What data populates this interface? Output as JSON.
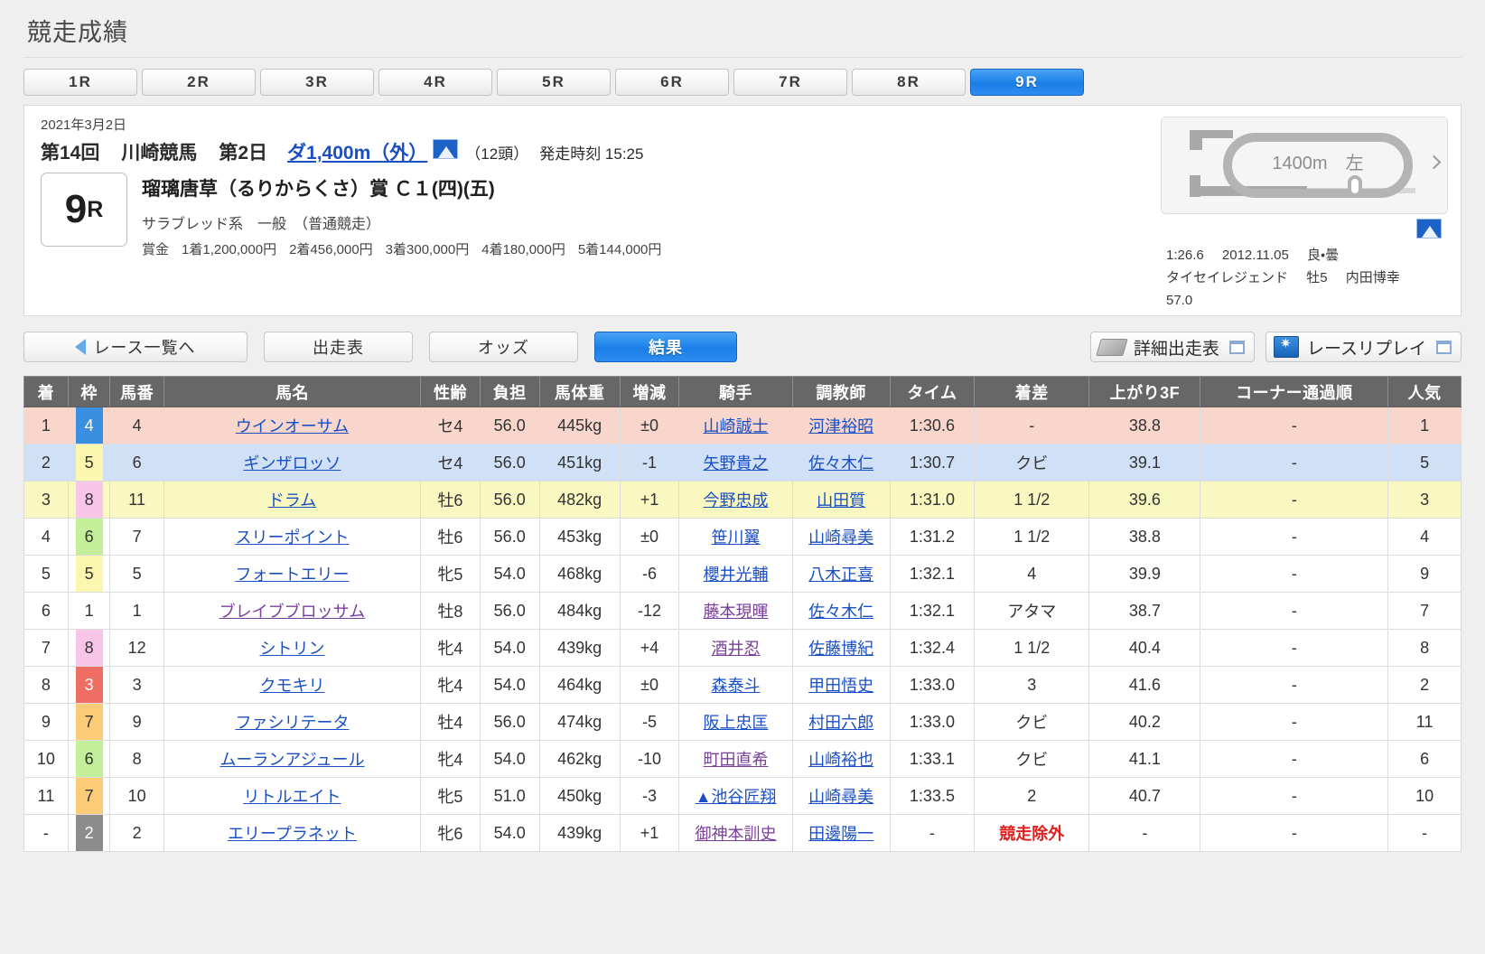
{
  "page": {
    "title": "競走成績"
  },
  "race_tabs": [
    {
      "label": "1R",
      "active": false
    },
    {
      "label": "2R",
      "active": false
    },
    {
      "label": "3R",
      "active": false
    },
    {
      "label": "4R",
      "active": false
    },
    {
      "label": "5R",
      "active": false
    },
    {
      "label": "6R",
      "active": false
    },
    {
      "label": "7R",
      "active": false
    },
    {
      "label": "8R",
      "active": false
    },
    {
      "label": "9R",
      "active": true
    }
  ],
  "race_info": {
    "date": "2021年3月2日",
    "kai": "第14回",
    "place": "川崎競馬",
    "day": "第2日",
    "distance_link": "ダ1,400m（外）",
    "head_count": "（12頭）",
    "start_time": "発走時刻 15:25",
    "race_no_num": "9",
    "race_no_suffix": "R",
    "race_name": "瑠璃唐草（るりからくさ）賞 Ｃ１(四)(五)",
    "condition": "サラブレッド系　一般　（普通競走）",
    "prize_label": "賞金",
    "prizes": [
      "1着1,200,000円",
      "2着456,000円",
      "3着300,000円",
      "4着180,000円",
      "5着144,000円"
    ]
  },
  "course": {
    "diagram_label": "1400m　左",
    "record_time": "1:26.6",
    "record_date": "2012.11.05",
    "record_cond": "良・曇",
    "record_horse": "タイセイレジェンド",
    "record_sex_age": "牡5",
    "record_jockey": "内田博幸",
    "record_weight": "57.0"
  },
  "nav_buttons": [
    {
      "label": "レース一覧へ",
      "active": false,
      "icon": "back-arrow-icon"
    },
    {
      "label": "出走表",
      "active": false,
      "icon": ""
    },
    {
      "label": "オッズ",
      "active": false,
      "icon": ""
    },
    {
      "label": "結果",
      "active": true,
      "icon": ""
    }
  ],
  "right_links": [
    {
      "label": "詳細出走表",
      "icon": "card-icon"
    },
    {
      "label": "レースリプレイ",
      "icon": "replay-icon"
    }
  ],
  "table": {
    "headers": [
      "着",
      "枠",
      "馬番",
      "馬名",
      "性齢",
      "負担",
      "馬体重",
      "増減",
      "騎手",
      "調教師",
      "タイム",
      "着差",
      "上がり3F",
      "コーナー通過順",
      "人気"
    ],
    "rows": [
      {
        "chaku": "1",
        "waku": "4",
        "umaban": "4",
        "name": "ウインオーサム",
        "sei": "セ4",
        "futan": "56.0",
        "weight": "445kg",
        "zougen": "±0",
        "jockey": "山崎誠士",
        "trainer": "河津裕昭",
        "time": "1:30.6",
        "diff": "-",
        "agari": "38.8",
        "corner": "-",
        "ninki": "1",
        "rank_class": "row-1",
        "jockey_visited": false,
        "name_visited": false,
        "excluded": false
      },
      {
        "chaku": "2",
        "waku": "5",
        "umaban": "6",
        "name": "ギンザロッソ",
        "sei": "セ4",
        "futan": "56.0",
        "weight": "451kg",
        "zougen": "-1",
        "jockey": "矢野貴之",
        "trainer": "佐々木仁",
        "time": "1:30.7",
        "diff": "クビ",
        "agari": "39.1",
        "corner": "-",
        "ninki": "5",
        "rank_class": "row-2",
        "jockey_visited": false,
        "name_visited": false,
        "excluded": false
      },
      {
        "chaku": "3",
        "waku": "8",
        "umaban": "11",
        "name": "ドラム",
        "sei": "牡6",
        "futan": "56.0",
        "weight": "482kg",
        "zougen": "+1",
        "jockey": "今野忠成",
        "trainer": "山田質",
        "time": "1:31.0",
        "diff": "1 1/2",
        "agari": "39.6",
        "corner": "-",
        "ninki": "3",
        "rank_class": "row-3",
        "jockey_visited": false,
        "name_visited": false,
        "excluded": false
      },
      {
        "chaku": "4",
        "waku": "6",
        "umaban": "7",
        "name": "スリーポイント",
        "sei": "牡6",
        "futan": "56.0",
        "weight": "453kg",
        "zougen": "±0",
        "jockey": "笹川翼",
        "trainer": "山崎尋美",
        "time": "1:31.2",
        "diff": "1 1/2",
        "agari": "38.8",
        "corner": "-",
        "ninki": "4",
        "rank_class": "",
        "jockey_visited": false,
        "name_visited": false,
        "excluded": false
      },
      {
        "chaku": "5",
        "waku": "5",
        "umaban": "5",
        "name": "フォートエリー",
        "sei": "牝5",
        "futan": "54.0",
        "weight": "468kg",
        "zougen": "-6",
        "jockey": "櫻井光輔",
        "trainer": "八木正喜",
        "time": "1:32.1",
        "diff": "4",
        "agari": "39.9",
        "corner": "-",
        "ninki": "9",
        "rank_class": "",
        "jockey_visited": false,
        "name_visited": false,
        "excluded": false
      },
      {
        "chaku": "6",
        "waku": "1",
        "umaban": "1",
        "name": "ブレイブブロッサム",
        "sei": "牡8",
        "futan": "56.0",
        "weight": "484kg",
        "zougen": "-12",
        "jockey": "藤本現暉",
        "trainer": "佐々木仁",
        "time": "1:32.1",
        "diff": "アタマ",
        "agari": "38.7",
        "corner": "-",
        "ninki": "7",
        "rank_class": "",
        "jockey_visited": true,
        "name_visited": true,
        "excluded": false
      },
      {
        "chaku": "7",
        "waku": "8",
        "umaban": "12",
        "name": "シトリン",
        "sei": "牝4",
        "futan": "54.0",
        "weight": "439kg",
        "zougen": "+4",
        "jockey": "酒井忍",
        "trainer": "佐藤博紀",
        "time": "1:32.4",
        "diff": "1 1/2",
        "agari": "40.4",
        "corner": "-",
        "ninki": "8",
        "rank_class": "",
        "jockey_visited": true,
        "name_visited": false,
        "excluded": false
      },
      {
        "chaku": "8",
        "waku": "3",
        "umaban": "3",
        "name": "クモキリ",
        "sei": "牝4",
        "futan": "54.0",
        "weight": "464kg",
        "zougen": "±0",
        "jockey": "森泰斗",
        "trainer": "甲田悟史",
        "time": "1:33.0",
        "diff": "3",
        "agari": "41.6",
        "corner": "-",
        "ninki": "2",
        "rank_class": "",
        "jockey_visited": false,
        "name_visited": false,
        "excluded": false
      },
      {
        "chaku": "9",
        "waku": "7",
        "umaban": "9",
        "name": "ファシリテータ",
        "sei": "牡4",
        "futan": "56.0",
        "weight": "474kg",
        "zougen": "-5",
        "jockey": "阪上忠匡",
        "trainer": "村田六郎",
        "time": "1:33.0",
        "diff": "クビ",
        "agari": "40.2",
        "corner": "-",
        "ninki": "11",
        "rank_class": "",
        "jockey_visited": false,
        "name_visited": false,
        "excluded": false
      },
      {
        "chaku": "10",
        "waku": "6",
        "umaban": "8",
        "name": "ムーランアジュール",
        "sei": "牝4",
        "futan": "54.0",
        "weight": "462kg",
        "zougen": "-10",
        "jockey": "町田直希",
        "trainer": "山崎裕也",
        "time": "1:33.1",
        "diff": "クビ",
        "agari": "41.1",
        "corner": "-",
        "ninki": "6",
        "rank_class": "",
        "jockey_visited": true,
        "name_visited": false,
        "excluded": false
      },
      {
        "chaku": "11",
        "waku": "7",
        "umaban": "10",
        "name": "リトルエイト",
        "sei": "牝5",
        "futan": "51.0",
        "weight": "450kg",
        "zougen": "-3",
        "jockey": "▲池谷匠翔",
        "trainer": "山崎尋美",
        "time": "1:33.5",
        "diff": "2",
        "agari": "40.7",
        "corner": "-",
        "ninki": "10",
        "rank_class": "",
        "jockey_visited": false,
        "name_visited": false,
        "excluded": false
      },
      {
        "chaku": "-",
        "waku": "2",
        "umaban": "2",
        "name": "エリープラネット",
        "sei": "牝6",
        "futan": "54.0",
        "weight": "439kg",
        "zougen": "+1",
        "jockey": "御神本訓史",
        "trainer": "田邊陽一",
        "time": "-",
        "diff": "競走除外",
        "agari": "-",
        "corner": "-",
        "ninki": "-",
        "rank_class": "",
        "jockey_visited": true,
        "name_visited": false,
        "excluded": true
      }
    ]
  }
}
